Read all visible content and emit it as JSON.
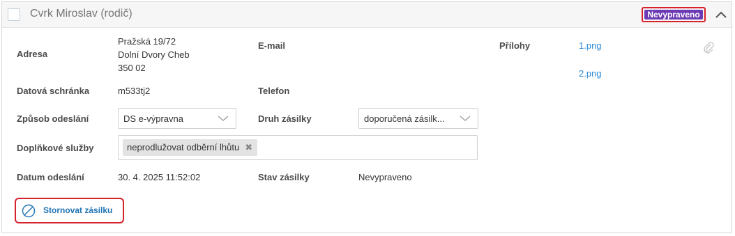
{
  "header": {
    "title": "Cvrk Miroslav (rodič)",
    "status_badge": "Nevypraveno"
  },
  "fields": {
    "address_label": "Adresa",
    "address_lines": [
      "Pražská 19/72",
      "Dolní Dvory Cheb",
      "350 02"
    ],
    "email_label": "E-mail",
    "attachments_label": "Přílohy",
    "attachments": [
      "1.png",
      "2.png"
    ],
    "databox_label": "Datová schránka",
    "databox_value": "m533tj2",
    "phone_label": "Telefon",
    "send_method_label": "Způsob odeslání",
    "send_method_value": "DS e-výpravna",
    "shipment_type_label": "Druh zásilky",
    "shipment_type_value": "doporučená zásilk...",
    "extra_services_label": "Doplňkové služby",
    "extra_services_tags": [
      "neprodlužovat odběrní lhůtu"
    ],
    "send_date_label": "Datum odeslání",
    "send_date_value": "30. 4. 2025 11:52:02",
    "shipment_state_label": "Stav zásilky",
    "shipment_state_value": "Nevypraveno"
  },
  "actions": {
    "cancel_label": "Stornovat zásilku"
  },
  "colors": {
    "badge_bg": "#6c3ab4",
    "highlight_border": "#d6222a",
    "link": "#2b8bd8",
    "action_text": "#1f74b6"
  },
  "icons": {
    "collapse": "chevron-up-icon",
    "attachment": "paperclip-icon",
    "cancel": "cancel-circle-icon",
    "dropdown": "chevron-down-icon",
    "remove_tag": "close-icon"
  }
}
